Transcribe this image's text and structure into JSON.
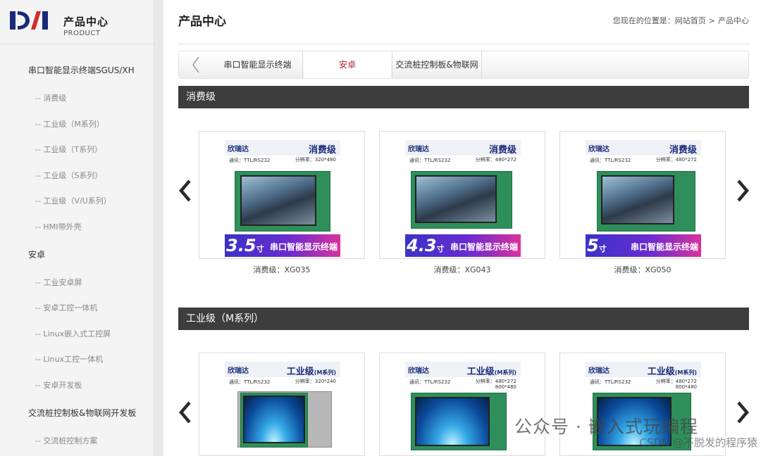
{
  "logo": {
    "cn": "产品中心",
    "en": "PRODUCT"
  },
  "sidebar": {
    "categories": [
      {
        "label": "串口智能显示终端SGUS/XH",
        "items": [
          "-- 消费级",
          "-- 工业级（M系列）",
          "-- 工业级（T系列）",
          "-- 工业级（S系列）",
          "-- 工业级（V/U系列）",
          "-- HMI带外壳"
        ]
      },
      {
        "label": "安卓",
        "items": [
          "-- 工业安卓屏",
          "-- 安卓工控一体机",
          "-- Linux嵌入式工控屏",
          "-- Linux工控一体机",
          "-- 安卓开发板"
        ]
      },
      {
        "label": "交流桩控制板&物联网开发板",
        "items": [
          "-- 交流桩控制方案"
        ]
      }
    ]
  },
  "header": {
    "title": "产品中心",
    "breadcrumb_prefix": "您现在的位置是：",
    "breadcrumb_home": "网站首页",
    "breadcrumb_sep": ">",
    "breadcrumb_current": "产品中心"
  },
  "tabs": [
    "串口智能显示终端",
    "安卓",
    "交流桩控制板&物联网"
  ],
  "colors": {
    "active_tab": "#b02525",
    "section_bar": "#3d3d3d",
    "sidebar_bg": "#f4f4f4"
  },
  "sections": [
    {
      "title": "消费级",
      "products": [
        {
          "caption": "消费级：XG035",
          "size": "3.5",
          "unit": "寸",
          "grade": "消费级",
          "grade_suffix": "",
          "brand": "欣瑞达",
          "spec1": "通讯：TTL/RS232",
          "spec2": "分辨率：320*480",
          "banner": "串口智能显示终端"
        },
        {
          "caption": "消费级：XG043",
          "size": "4.3",
          "unit": "寸",
          "grade": "消费级",
          "grade_suffix": "",
          "brand": "欣瑞达",
          "spec1": "通讯：TTL/RS232",
          "spec2": "分辨率：480*272",
          "banner": "串口智能显示终端"
        },
        {
          "caption": "消费级：XG050",
          "size": "5",
          "unit": "寸",
          "grade": "消费级",
          "grade_suffix": "",
          "brand": "欣瑞达",
          "spec1": "通讯：TTL/RS232",
          "spec2": "分辨率：480*272",
          "banner": "串口智能显示终端"
        }
      ]
    },
    {
      "title": "工业级（M系列）",
      "products": [
        {
          "grade": "工业级",
          "grade_suffix": "(M系列)",
          "brand": "欣瑞达",
          "spec1": "通讯：TTL/RS232",
          "spec2": "分辨率：320*240",
          "spec3": ""
        },
        {
          "grade": "工业级",
          "grade_suffix": "(M系列)",
          "brand": "欣瑞达",
          "spec1": "通讯：TTL/RS232",
          "spec2": "分辨率：480*272",
          "spec3": "800*480"
        },
        {
          "grade": "工业级",
          "grade_suffix": "(M系列)",
          "brand": "欣瑞达",
          "spec1": "通讯：TTL/RS232",
          "spec2": "分辨率：480*272",
          "spec3": "800*480"
        }
      ]
    }
  ],
  "watermark": {
    "main": "公众号 · 嵌入式玩编程",
    "sub": "CSDN @不脱发的程序猿"
  }
}
